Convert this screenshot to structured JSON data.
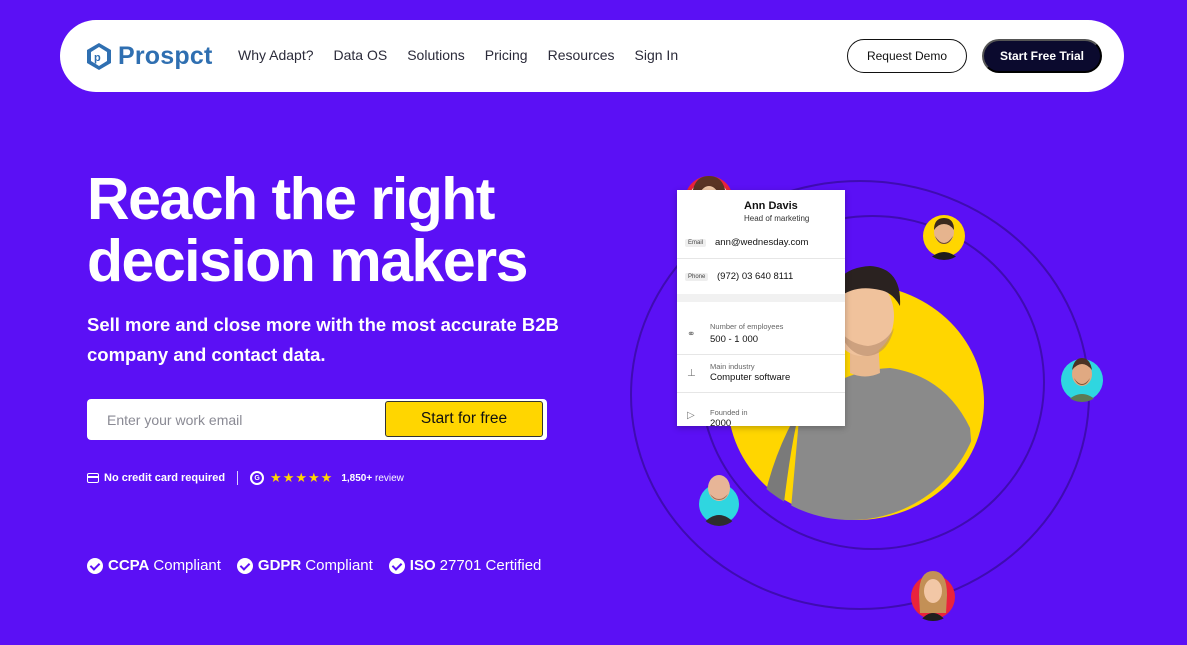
{
  "nav": {
    "logo_text": "Prospct",
    "links": [
      "Why Adapt?",
      "Data OS",
      "Solutions",
      "Pricing",
      "Resources",
      "Sign In"
    ],
    "request_demo": "Request Demo",
    "start_trial": "Start Free Trial"
  },
  "hero": {
    "title_line1": "Reach the right",
    "title_line2": "decision makers",
    "subtitle": "Sell more and close more with the most accurate B2B company and contact data.",
    "email_placeholder": "Enter your work email",
    "cta": "Start for free"
  },
  "trust": {
    "no_card": "No credit card required",
    "g2_letter": "G",
    "rating_stars": 5,
    "reviews_count": "1,850+",
    "reviews_word": "review"
  },
  "compliance": [
    {
      "strong": "CCPA",
      "rest": "Compliant"
    },
    {
      "strong": "GDPR",
      "rest": "Compliant"
    },
    {
      "strong": "ISO",
      "rest": "27701 Certified"
    }
  ],
  "profile_card": {
    "name": "Ann Davis",
    "role": "Head of marketing",
    "email_label": "Email",
    "email": "ann@wednesday.com",
    "phone_label": "Phone",
    "phone": "(972) 03 640 8111",
    "employees_label": "Number of employees",
    "employees": "500 - 1 000",
    "industry_label": "Main industry",
    "industry": "Computer software",
    "founded_label": "Founded in",
    "founded": "2000"
  },
  "colors": {
    "background": "#5b10f5",
    "accent_yellow": "#ffd600",
    "brand_blue": "#2f6fb1",
    "dark_button": "#0b0a2e"
  }
}
